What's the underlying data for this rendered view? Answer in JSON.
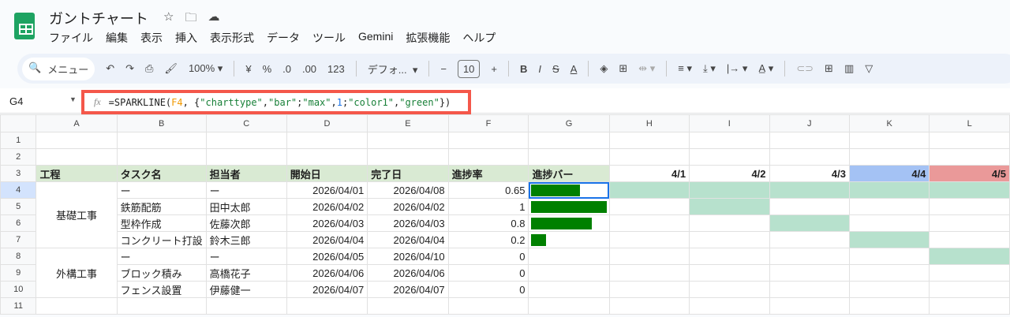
{
  "title": "ガントチャート",
  "menu": [
    "ファイル",
    "編集",
    "表示",
    "挿入",
    "表示形式",
    "データ",
    "ツール",
    "Gemini",
    "拡張機能",
    "ヘルプ"
  ],
  "toolbar": {
    "search": "メニュー",
    "zoom": "100%",
    "currency": "¥",
    "percent": "%",
    "dec_dec": ".0",
    "inc_dec": ".00",
    "number": "123",
    "font": "デフォ...",
    "font_size": "10"
  },
  "name_box": "G4",
  "formula": {
    "fn": "=SPARKLINE(",
    "ref": "F4",
    "rest": [
      ", {",
      "\"charttype\"",
      ",",
      "\"bar\"",
      ";",
      "\"max\"",
      ",",
      "1",
      ";",
      "\"color1\"",
      ",",
      "\"green\"",
      "})"
    ]
  },
  "columns": [
    "A",
    "B",
    "C",
    "D",
    "E",
    "F",
    "G",
    "H",
    "I",
    "J",
    "K",
    "L"
  ],
  "rows": [
    "1",
    "2",
    "3",
    "4",
    "5",
    "6",
    "7",
    "8",
    "9",
    "10",
    "11"
  ],
  "headers": [
    "工程",
    "タスク名",
    "担当者",
    "開始日",
    "完了日",
    "進捗率",
    "進捗バー"
  ],
  "dates": [
    "4/1",
    "4/2",
    "4/3",
    "4/4",
    "4/5"
  ],
  "colors": {
    "header": "#d9ead3",
    "gantt": "#b7e1cd",
    "date4": "#a4c2f4",
    "date5": "#ea9999",
    "bar": "#008000"
  },
  "groups": [
    "基礎工事",
    "外構工事"
  ],
  "tasks": [
    {
      "name": "ー",
      "owner": "ー",
      "start": "2026/04/01",
      "end": "2026/04/08",
      "progress": "0.65",
      "fill": 0.65,
      "gantt": [
        1,
        1,
        1,
        1,
        1
      ]
    },
    {
      "name": "鉄筋配筋",
      "owner": "田中太郎",
      "start": "2026/04/02",
      "end": "2026/04/02",
      "progress": "1",
      "fill": 1,
      "gantt": [
        0,
        1,
        0,
        0,
        0
      ]
    },
    {
      "name": "型枠作成",
      "owner": "佐藤次郎",
      "start": "2026/04/03",
      "end": "2026/04/03",
      "progress": "0.8",
      "fill": 0.8,
      "gantt": [
        0,
        0,
        1,
        0,
        0
      ]
    },
    {
      "name": "コンクリート打設",
      "owner": "鈴木三郎",
      "start": "2026/04/04",
      "end": "2026/04/04",
      "progress": "0.2",
      "fill": 0.2,
      "gantt": [
        0,
        0,
        0,
        1,
        0
      ]
    },
    {
      "name": "ー",
      "owner": "ー",
      "start": "2026/04/05",
      "end": "2026/04/10",
      "progress": "0",
      "fill": 0,
      "gantt": [
        0,
        0,
        0,
        0,
        1
      ]
    },
    {
      "name": "ブロック積み",
      "owner": "高橋花子",
      "start": "2026/04/06",
      "end": "2026/04/06",
      "progress": "0",
      "fill": 0,
      "gantt": [
        0,
        0,
        0,
        0,
        0
      ]
    },
    {
      "name": "フェンス設置",
      "owner": "伊藤健一",
      "start": "2026/04/07",
      "end": "2026/04/07",
      "progress": "0",
      "fill": 0,
      "gantt": [
        0,
        0,
        0,
        0,
        0
      ]
    }
  ]
}
